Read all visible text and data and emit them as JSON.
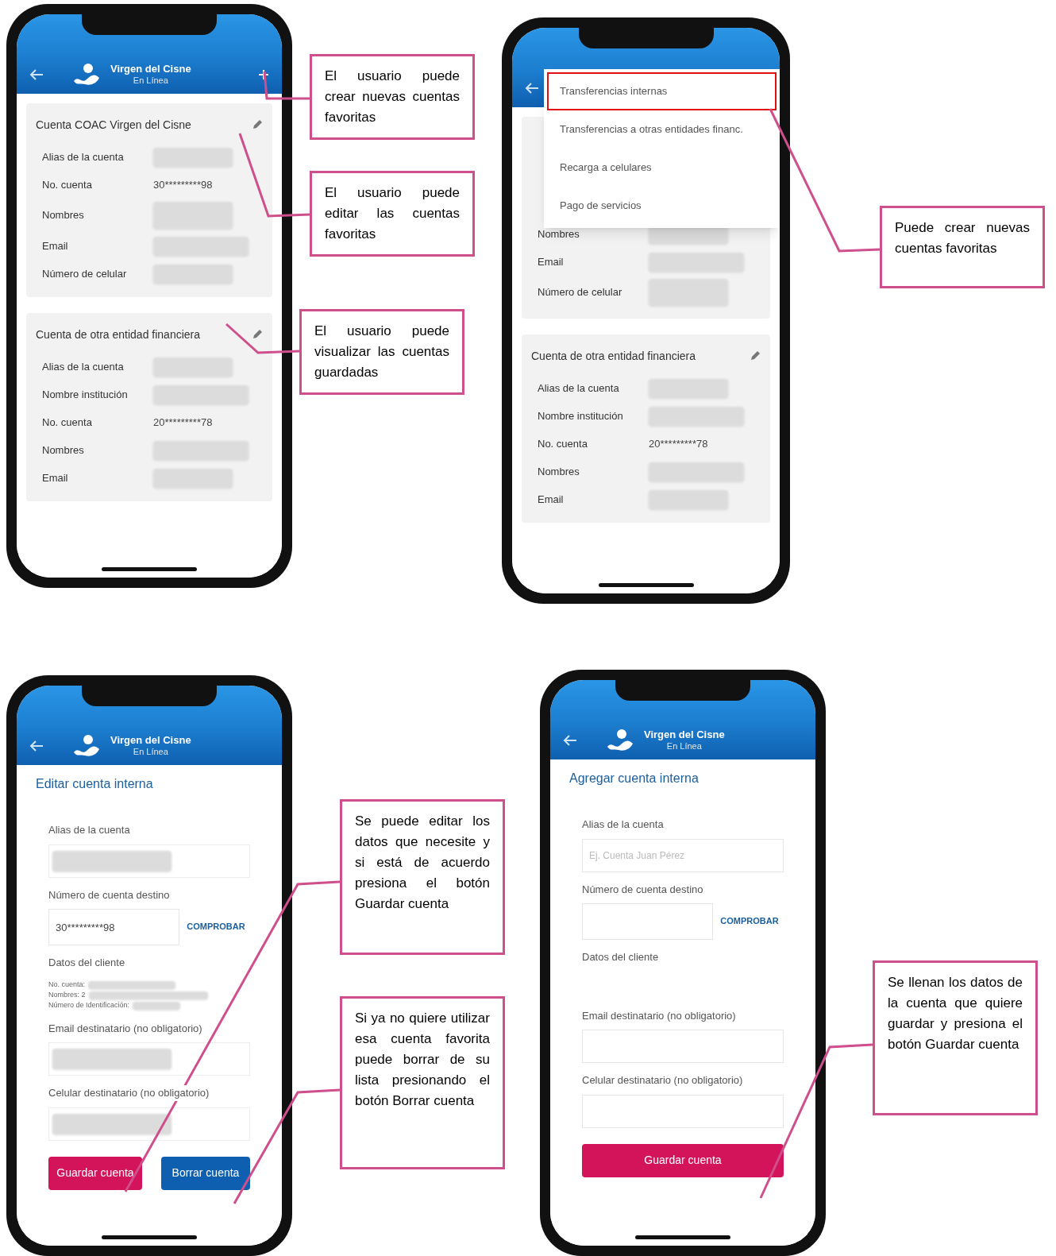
{
  "phones": [
    {
      "kind": "list",
      "header": {
        "brand": "Virgen del Cisne",
        "tagline": "En Línea",
        "add": true
      },
      "cards": [
        {
          "title": "Cuenta COAC Virgen del Cisne",
          "editable": true,
          "rows": [
            {
              "label": "Alias de la cuenta",
              "kind": "masked"
            },
            {
              "label": "No. cuenta",
              "kind": "text",
              "value": "30*********98"
            },
            {
              "label": "Nombres",
              "kind": "masked"
            },
            {
              "label": "Email",
              "kind": "masked"
            },
            {
              "label": "Número de celular",
              "kind": "masked"
            }
          ]
        },
        {
          "title": "Cuenta de otra entidad financiera",
          "editable": true,
          "rows": [
            {
              "label": "Alias de la cuenta",
              "kind": "masked"
            },
            {
              "label": "Nombre institución",
              "kind": "masked"
            },
            {
              "label": "No. cuenta",
              "kind": "text",
              "value": "20*********78"
            },
            {
              "label": "Nombres",
              "kind": "masked"
            },
            {
              "label": "Email",
              "kind": "masked"
            }
          ]
        }
      ]
    },
    {
      "kind": "list",
      "header": {
        "add": false
      },
      "menu": [
        {
          "label": "Transferencias internas",
          "selected": true
        },
        {
          "label": "Transferencias a otras entidades financ.",
          "selected": false
        },
        {
          "label": "Recarga a celulares",
          "selected": false
        },
        {
          "label": "Pago de servicios",
          "selected": false
        }
      ],
      "cards": [
        {
          "editable": false,
          "rows": [
            {
              "label": "Nombres",
              "kind": "masked"
            },
            {
              "label": "Email",
              "kind": "masked"
            },
            {
              "label": "Número de celular",
              "kind": "masked"
            }
          ]
        },
        {
          "title": "Cuenta de otra entidad financiera",
          "editable": true,
          "rows": [
            {
              "label": "Alias de la cuenta",
              "kind": "masked"
            },
            {
              "label": "Nombre institución",
              "kind": "masked"
            },
            {
              "label": "No. cuenta",
              "kind": "text",
              "value": "20*********78"
            },
            {
              "label": "Nombres",
              "kind": "masked"
            },
            {
              "label": "Email",
              "kind": "masked"
            }
          ]
        }
      ]
    },
    {
      "kind": "form",
      "header": {
        "brand": "Virgen del Cisne",
        "tagline": "En Línea",
        "add": false
      },
      "title": "Editar cuenta interna",
      "fields": [
        {
          "kind": "input",
          "label": "Alias de la cuenta",
          "masked": true
        },
        {
          "kind": "account",
          "label": "Número de cuenta destino",
          "value": "30*********98",
          "action": "COMPROBAR"
        },
        {
          "kind": "client",
          "label": "Datos del cliente",
          "lines": [
            "No. cuenta:",
            "Nombres: 2",
            "Número de Identificación:"
          ]
        },
        {
          "kind": "input",
          "label": "Email destinatario (no obligatorio)",
          "masked": true
        },
        {
          "kind": "input",
          "label": "Celular destinatario (no obligatorio)",
          "masked": true
        }
      ],
      "buttons": [
        {
          "label": "Guardar cuenta",
          "kind": "save"
        },
        {
          "label": "Borrar cuenta",
          "kind": "delete"
        }
      ]
    },
    {
      "kind": "form",
      "header": {
        "brand": "Virgen del Cisne",
        "tagline": "En Línea",
        "add": false
      },
      "title": "Agregar cuenta interna",
      "fields": [
        {
          "kind": "input",
          "label": "Alias de la cuenta",
          "placeholder": "Ej. Cuenta Juan Pérez",
          "masked": false
        },
        {
          "kind": "account",
          "label": "Número de cuenta destino",
          "action": "COMPROBAR"
        },
        {
          "kind": "client",
          "label": "Datos del cliente"
        },
        {
          "kind": "input",
          "label": "Email destinatario (no obligatorio)",
          "masked": false
        },
        {
          "kind": "input",
          "label": "Celular destinatario (no obligatorio)",
          "masked": false
        }
      ],
      "buttons": [
        {
          "label": "Guardar cuenta",
          "kind": "save_wide"
        }
      ]
    }
  ],
  "callouts": [
    "El usuario puede crear nuevas cuentas favoritas",
    "El usuario puede editar las cuentas favoritas",
    "El usuario puede visualizar las cuentas guardadas",
    "Puede crear nuevas cuentas favoritas",
    "Se puede editar los datos que necesite y si está de acuerdo presiona el botón Guardar cuenta",
    "Si ya no quiere utilizar esa cuenta favorita puede borrar de su lista presionando el botón Borrar cuenta",
    "Se llenan los datos de la cuenta que quiere guardar y presiona el botón Guardar cuenta"
  ]
}
